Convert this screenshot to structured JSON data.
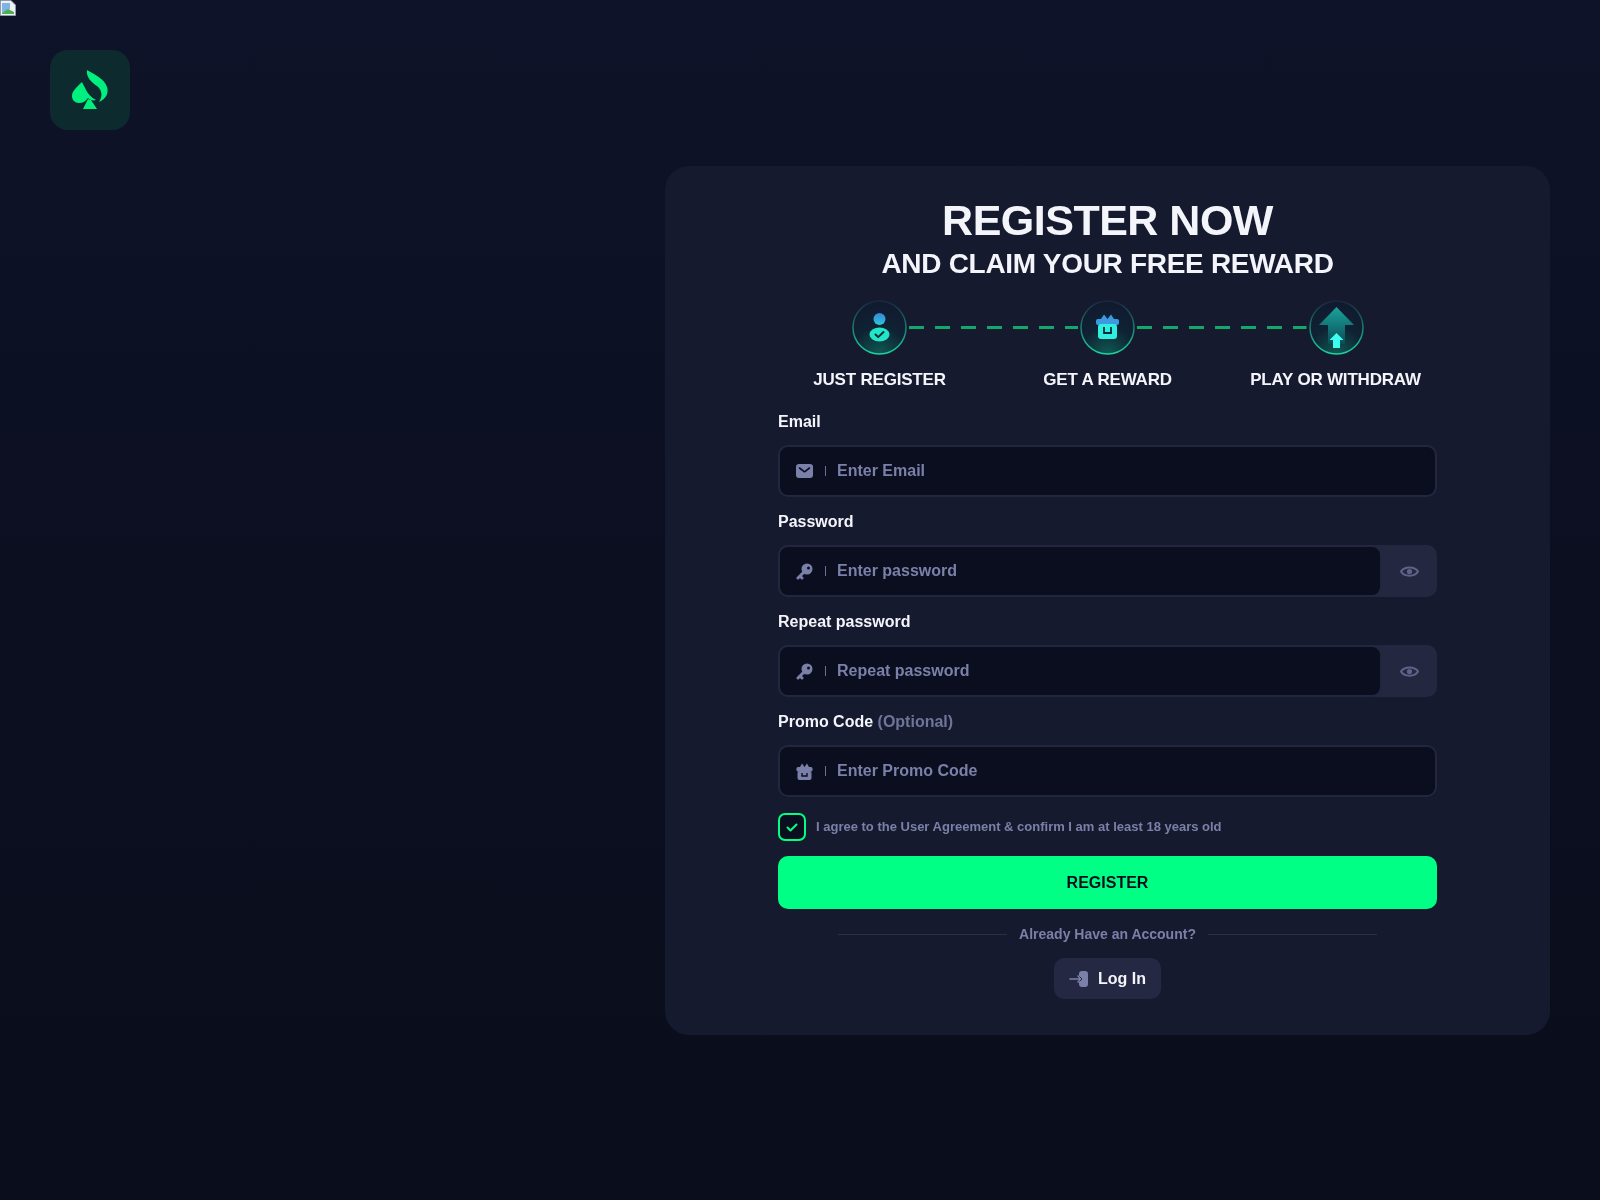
{
  "header": {
    "title": "REGISTER NOW",
    "subtitle": "AND CLAIM YOUR FREE REWARD"
  },
  "steps": [
    {
      "label": "JUST REGISTER"
    },
    {
      "label": "GET A REWARD"
    },
    {
      "label": "PLAY OR WITHDRAW"
    }
  ],
  "form": {
    "fields": [
      {
        "kind": "email",
        "label": "Email",
        "placeholder": "Enter Email"
      },
      {
        "kind": "password",
        "label": "Password",
        "placeholder": "Enter password"
      },
      {
        "kind": "password",
        "label": "Repeat password",
        "placeholder": "Repeat password"
      },
      {
        "kind": "promo",
        "label": "Promo Code",
        "note": "(Optional)",
        "placeholder": "Enter Promo Code"
      }
    ],
    "agreement": {
      "checked": true,
      "text": "I agree to the User Agreement & confirm I am at least 18 years old"
    },
    "submit_button": "REGISTER",
    "login_prompt": "Already Have an Account?",
    "login_button": "Log In"
  }
}
